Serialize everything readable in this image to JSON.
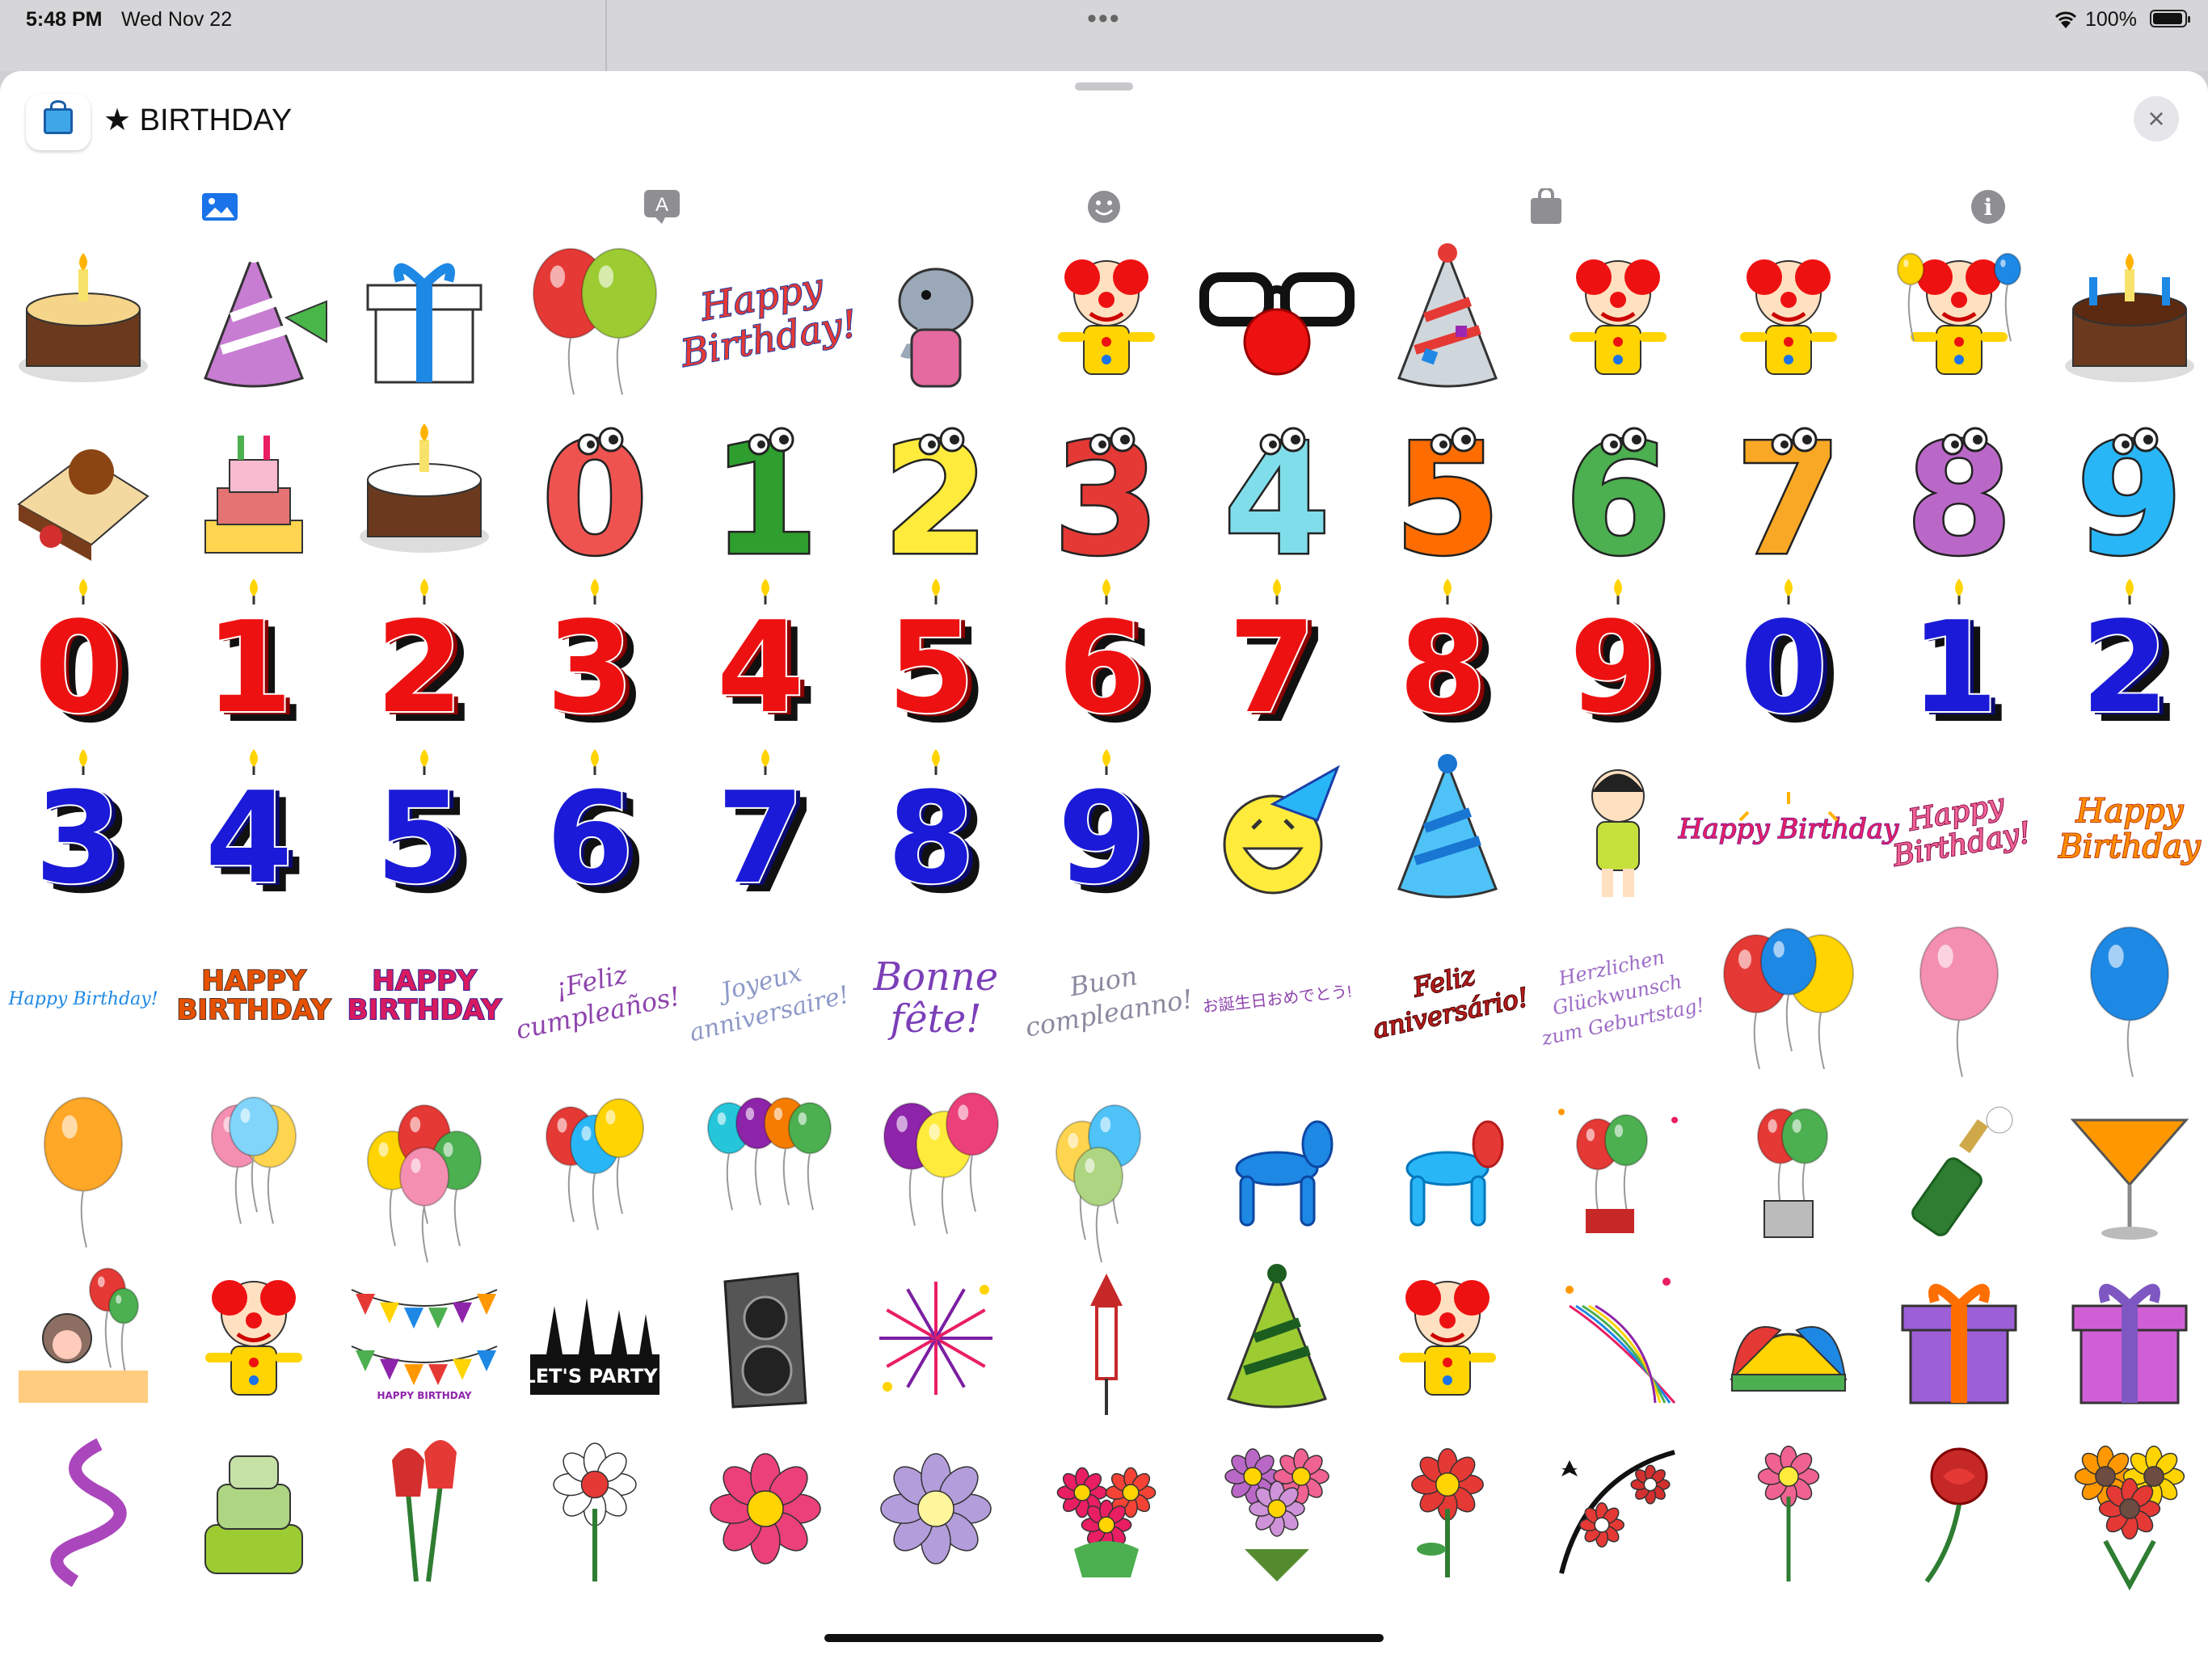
{
  "status_bar": {
    "time": "5:48 PM",
    "date": "Wed Nov 22",
    "battery": "100%"
  },
  "sheet": {
    "title": "★ BIRTHDAY",
    "close_icon": "×"
  },
  "tabs": [
    {
      "name": "tab-images",
      "icon": "photo-icon"
    },
    {
      "name": "tab-text",
      "icon": "text-bubble-icon",
      "label": "A"
    },
    {
      "name": "tab-emoji",
      "icon": "smiley-icon"
    },
    {
      "name": "tab-store",
      "icon": "shopping-bag-icon"
    },
    {
      "name": "tab-info",
      "icon": "info-icon",
      "label": "i"
    }
  ],
  "rows": [
    [
      "cake-candle",
      "party-horn",
      "gift-box",
      "balloons-pair",
      "happy-birthday-text",
      "elephant",
      "clown-jumping",
      "funny-glasses",
      "party-hat",
      "jester",
      "clown-dancing",
      "clown-balloons",
      "birthday-cake-candles"
    ],
    [
      "cake-slice",
      "cake-tiers",
      "cake-small",
      "cartoon-0",
      "cartoon-1",
      "cartoon-2",
      "cartoon-3",
      "cartoon-4",
      "cartoon-5",
      "cartoon-6",
      "cartoon-7",
      "cartoon-8",
      "cartoon-9"
    ],
    [
      "candle-red-0",
      "candle-red-1",
      "candle-red-2",
      "candle-red-3",
      "candle-red-4",
      "candle-red-5",
      "candle-red-6",
      "candle-red-7",
      "candle-red-8",
      "candle-red-9",
      "candle-blue-0",
      "candle-blue-1",
      "candle-blue-2"
    ],
    [
      "candle-blue-3",
      "candle-blue-4",
      "candle-blue-5",
      "candle-blue-6",
      "candle-blue-7",
      "candle-blue-8",
      "candle-blue-9",
      "smiley-party-hat",
      "blue-party-hat",
      "girl-confetti",
      "happy-birthday-sparkle",
      "happy-birthday-script",
      "happy-birthday-orange"
    ],
    [
      "happy-birthday-small",
      "happy-birthday-block",
      "happy-birthday-colorful",
      "feliz-cumpleanos",
      "joyeux-anniversaire",
      "bonne-fete",
      "buon-compleanno",
      "japanese-birthday",
      "feliz-aniversario",
      "herzlichen-glueckwunsch",
      "balloons-trio",
      "balloon-pink",
      "balloon-blue"
    ],
    [
      "balloon-orange",
      "balloons-pastel",
      "balloons-cluster",
      "balloons-bright",
      "balloons-bunch",
      "balloons-purple-yellow",
      "balloons-dotted",
      "balloon-dog-blue",
      "balloon-dog-red",
      "balloons-fireworks",
      "balloons-champagne",
      "champagne-bottle",
      "cocktail-glass"
    ],
    [
      "monkey-balloons",
      "juggler",
      "bunting-banner",
      "lets-party-sign",
      "speaker",
      "fireworks",
      "firework-rocket",
      "green-party-hat",
      "clown-red-hair",
      "confetti-streamers",
      "jester-hat",
      "gift-orange-ribbon",
      "gift-purple"
    ],
    [
      "streamer-ribbon",
      "green-cake",
      "red-tulips",
      "lily-flower",
      "pink-flower",
      "purple-flower",
      "flower-bouquet-small",
      "flower-bouquet",
      "red-flower",
      "floral-ornament",
      "pink-flower-stem",
      "red-rose",
      "gerbera-bouquet"
    ]
  ],
  "text_stickers": {
    "happy_birthday": [
      "Happy",
      "Birthday!"
    ],
    "happy_birthday_block": [
      "HAPPY",
      "BIRTHDAY"
    ],
    "happy_birthday_small": "Happy Birthday!",
    "happy_birthday_sparkle": "Happy Birthday",
    "happy_birthday_orange": [
      "Happy",
      "Birthday"
    ],
    "feliz_cumpleanos": [
      "¡Feliz",
      "cumpleaños!"
    ],
    "joyeux_anniversaire": [
      "Joyeux",
      "anniversaire!"
    ],
    "bonne_fete": [
      "Bonne",
      "fête!"
    ],
    "buon_compleanno": [
      "Buon",
      "compleanno!"
    ],
    "japanese": "お誕生日おめでとう!",
    "feliz_aniversario": [
      "Feliz",
      "aniversário!"
    ],
    "herzlichen": [
      "Herzlichen",
      "Glückwunsch",
      "zum Geburtstag!"
    ],
    "lets_party": "LET'S PARTY!",
    "bunting_caption": "HAPPY BIRTHDAY"
  },
  "colors": {
    "sheet_bg": "#ffffff",
    "accent": "#1a73e8",
    "icon_gray": "#8e8e93"
  }
}
